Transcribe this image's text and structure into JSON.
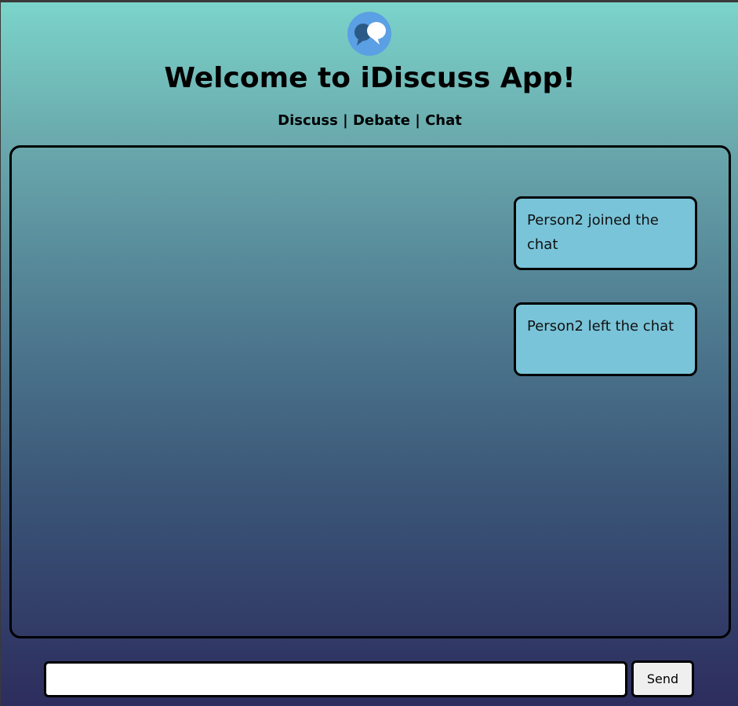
{
  "header": {
    "logo_icon": "speech-bubbles-icon",
    "title": "Welcome to iDiscuss App!",
    "nav": {
      "discuss": "Discuss",
      "debate": "Debate",
      "chat": "Chat",
      "separator": " | "
    }
  },
  "chat": {
    "messages": [
      {
        "text": "Person2 joined the chat"
      },
      {
        "text": "Person2 left the chat"
      }
    ]
  },
  "composer": {
    "input_value": "",
    "input_placeholder": "",
    "send_label": "Send"
  },
  "colors": {
    "message_bg": "#79c4d9",
    "logo_bg": "#5b9fe4",
    "gradient_top": "#7bd5cb",
    "gradient_bottom": "#2d2d5e"
  }
}
